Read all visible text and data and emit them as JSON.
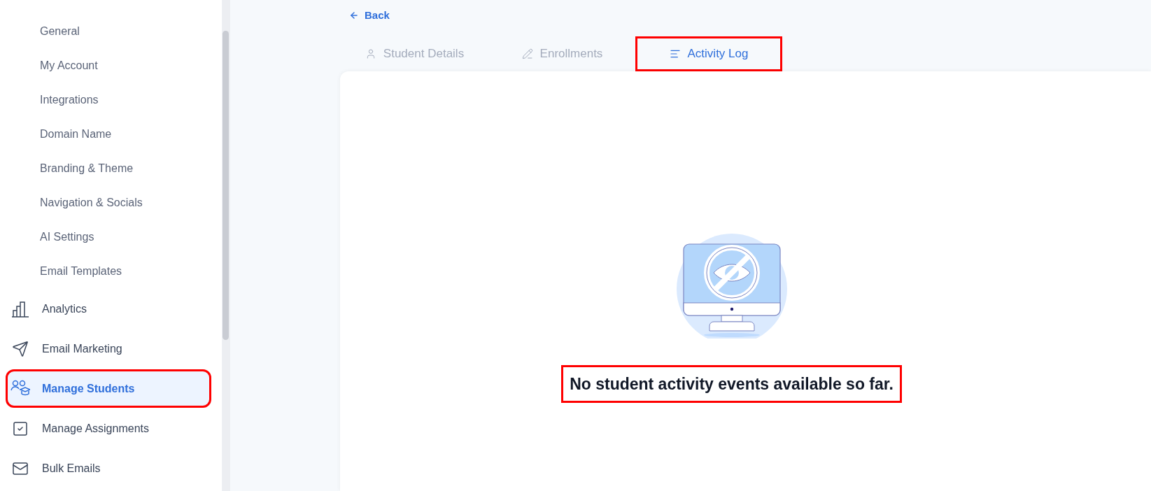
{
  "sidebar": {
    "sub_items": [
      {
        "label": "General"
      },
      {
        "label": "My Account"
      },
      {
        "label": "Integrations"
      },
      {
        "label": "Domain Name"
      },
      {
        "label": "Branding & Theme"
      },
      {
        "label": "Navigation & Socials"
      },
      {
        "label": "AI Settings"
      },
      {
        "label": "Email Templates"
      }
    ],
    "items": [
      {
        "label": "Analytics",
        "kind": "chart",
        "selected": false,
        "highlighted": false
      },
      {
        "label": "Email Marketing",
        "kind": "send",
        "selected": false,
        "highlighted": false
      },
      {
        "label": "Manage Students",
        "kind": "students",
        "selected": true,
        "highlighted": true
      },
      {
        "label": "Manage Assignments",
        "kind": "assignment",
        "selected": false,
        "highlighted": false
      },
      {
        "label": "Bulk Emails",
        "kind": "mail",
        "selected": false,
        "highlighted": false
      }
    ]
  },
  "back": {
    "label": "Back"
  },
  "tabs": [
    {
      "label": "Student Details",
      "kind": "user",
      "selected": false,
      "highlighted": false
    },
    {
      "label": "Enrollments",
      "kind": "pencil",
      "selected": false,
      "highlighted": false
    },
    {
      "label": "Activity Log",
      "kind": "list",
      "selected": true,
      "highlighted": true
    }
  ],
  "empty_state": {
    "message": "No student activity events available so far.",
    "highlighted": true
  }
}
